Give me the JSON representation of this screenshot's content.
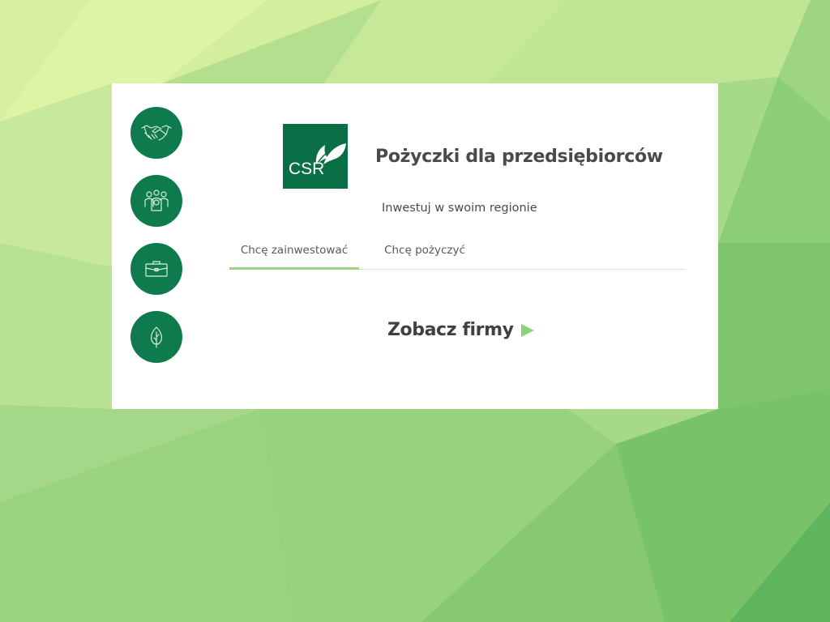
{
  "header": {
    "logo_text": "CSR",
    "title": "Pożyczki dla przedsiębiorców",
    "subtitle": "Inwestuj w swoim regionie"
  },
  "side_icons": [
    {
      "icon": "handshake-icon"
    },
    {
      "icon": "people-group-icon"
    },
    {
      "icon": "briefcase-icon"
    },
    {
      "icon": "leaf-icon"
    }
  ],
  "tabs": [
    {
      "label": "Chcę zainwestować",
      "active": true
    },
    {
      "label": "Chcę pożyczyć",
      "active": false
    }
  ],
  "cta": {
    "label": "Zobacz firmy"
  },
  "colors": {
    "brand_green": "#0f7a4e",
    "logo_green": "#0a6e47",
    "accent_light_green": "#9ed28a",
    "arrow_green": "#8fd07a",
    "text_dark": "#4a4a4a"
  }
}
